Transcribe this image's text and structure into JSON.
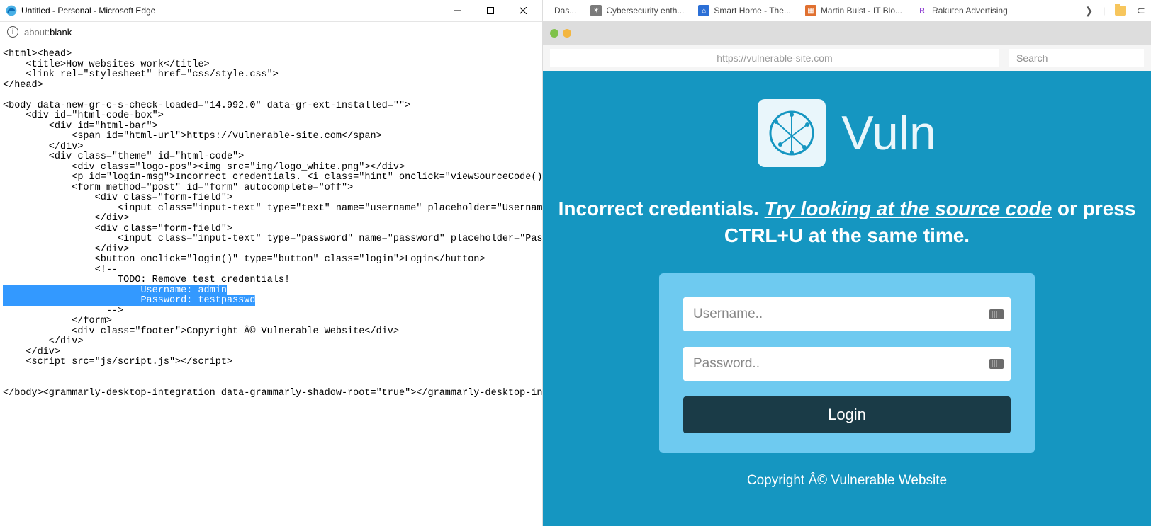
{
  "left_window": {
    "title": "Untitled - Personal - Microsoft Edge",
    "address_prefix": "about:",
    "address_suffix": "blank"
  },
  "source_lines": {
    "l0": "<html><head>",
    "l1": "    <title>How websites work</title>",
    "l2": "    <link rel=\"stylesheet\" href=\"css/style.css\">",
    "l3": "</head>",
    "l4": "",
    "l5": "<body data-new-gr-c-s-check-loaded=\"14.992.0\" data-gr-ext-installed=\"\">",
    "l6": "    <div id=\"html-code-box\">",
    "l7": "        <div id=\"html-bar\">",
    "l8": "            <span id=\"html-url\">https://vulnerable-site.com</span>",
    "l9": "        </div>",
    "l10": "        <div class=\"theme\" id=\"html-code\">",
    "l11": "            <div class=\"logo-pos\"><img src=\"img/logo_white.png\"></div>",
    "l12": "            <p id=\"login-msg\">Incorrect credentials. <i class=\"hint\" onclick=\"viewSourceCode()\">Try looking at ",
    "l13": "            <form method=\"post\" id=\"form\" autocomplete=\"off\">",
    "l14": "                <div class=\"form-field\">",
    "l15": "                    <input class=\"input-text\" type=\"text\" name=\"username\" placeholder=\"Username..\" autocomplete",
    "l16": "                </div>",
    "l17": "                <div class=\"form-field\">",
    "l18": "                    <input class=\"input-text\" type=\"password\" name=\"password\" placeholder=\"Password..\" autocomp",
    "l19": "                </div>",
    "l20": "                <button onclick=\"login()\" type=\"button\" class=\"login\">Login</button>",
    "l21": "                <!--",
    "l22_a": "                    TODO: Remove test credentials!",
    "l23_a": "                        ",
    "l23_b": "Username: admin",
    "l24_a": "                        ",
    "l24_b": "Password: testpasswd",
    "l25": "                  -->",
    "l26": "            </form>",
    "l27": "            <div class=\"footer\">Copyright Â© Vulnerable Website</div>",
    "l28": "        </div>",
    "l29": "    </div>",
    "l30": "    <script src=\"js/script.js\"></script>",
    "l31": "",
    "l32": "",
    "l33": "</body><grammarly-desktop-integration data-grammarly-shadow-root=\"true\"></grammarly-desktop-integration></html>"
  },
  "bookmarks": {
    "b0": "Das...",
    "b1": "Cybersecurity enth...",
    "b2": "Smart Home - The...",
    "b3": "Martin Buist - IT Blo...",
    "b4": "Rakuten Advertising"
  },
  "mock_chrome": {
    "url": "https://vulnerable-site.com",
    "search_placeholder": "Search"
  },
  "site": {
    "brand": "Vuln",
    "msg_prefix": "Incorrect credentials. ",
    "msg_hint": "Try looking at the source code",
    "msg_suffix": " or press CTRL+U at the same time.",
    "username_placeholder": "Username..",
    "password_placeholder": "Password..",
    "login_label": "Login",
    "footer": "Copyright Â© Vulnerable Website"
  }
}
